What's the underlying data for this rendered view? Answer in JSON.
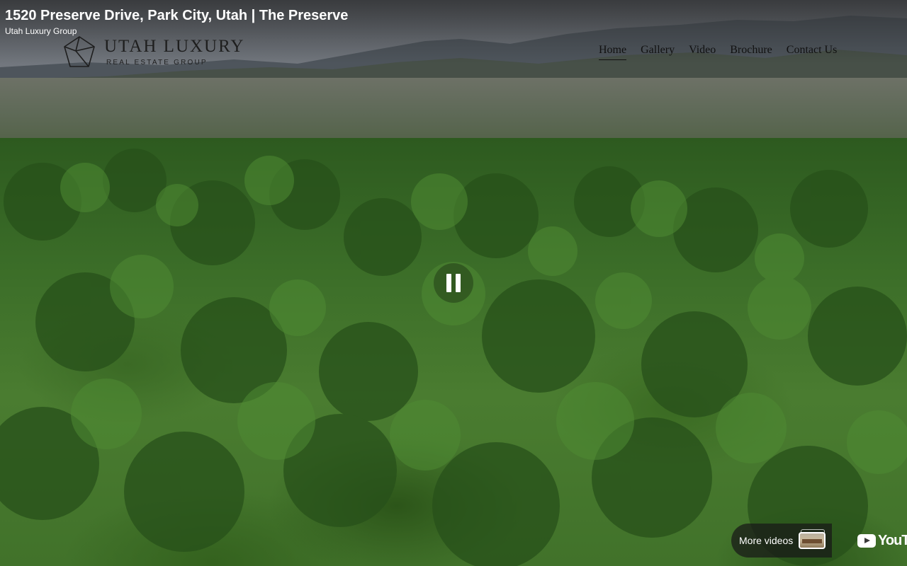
{
  "video": {
    "title": "1520 Preserve Drive, Park City, Utah | The Preserve",
    "channel": "Utah Luxury Group",
    "state": "playing"
  },
  "logo": {
    "main": "UTAH LUXURY",
    "sub": "REAL ESTATE GROUP"
  },
  "nav": {
    "items": [
      {
        "label": "Home",
        "active": true
      },
      {
        "label": "Gallery",
        "active": false
      },
      {
        "label": "Video",
        "active": false
      },
      {
        "label": "Brochure",
        "active": false
      },
      {
        "label": "Contact Us",
        "active": false
      }
    ]
  },
  "controls": {
    "pause_icon": "pause-icon",
    "more_videos_label": "More videos",
    "youtube_label": "YouTube"
  },
  "colors": {
    "text_light": "#ffffff",
    "text_dark": "#111111"
  }
}
